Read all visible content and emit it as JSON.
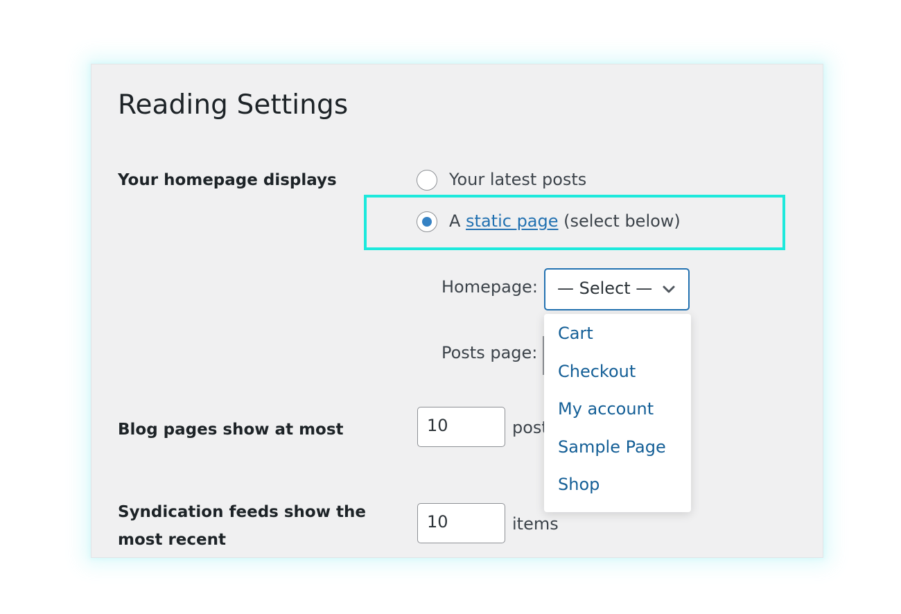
{
  "page": {
    "title": "Reading Settings"
  },
  "homepage_displays": {
    "label": "Your homepage displays",
    "options": [
      {
        "label": "Your latest posts",
        "selected": false
      },
      {
        "prefix": "A ",
        "link_text": "static page",
        "suffix": " (select below)",
        "selected": true
      }
    ]
  },
  "homepage_select": {
    "label": "Homepage:",
    "value": "— Select —",
    "options": [
      "Cart",
      "Checkout",
      "My account",
      "Sample Page",
      "Shop"
    ]
  },
  "posts_page_select": {
    "label": "Posts page:"
  },
  "blog_pages": {
    "label": "Blog pages show at most",
    "value": "10",
    "unit_visible": "post"
  },
  "syndication": {
    "label_line1": "Syndication feeds show the",
    "label_line2": "most recent",
    "value": "10",
    "unit": "items"
  },
  "colors": {
    "highlight": "#1de9dc",
    "accent": "#2271b1",
    "radio_selected": "#3582c4",
    "dropdown_text": "#135e96",
    "panel_background": "#f0f0f1"
  },
  "icons": {
    "select_arrow": "chevron-down-icon"
  }
}
